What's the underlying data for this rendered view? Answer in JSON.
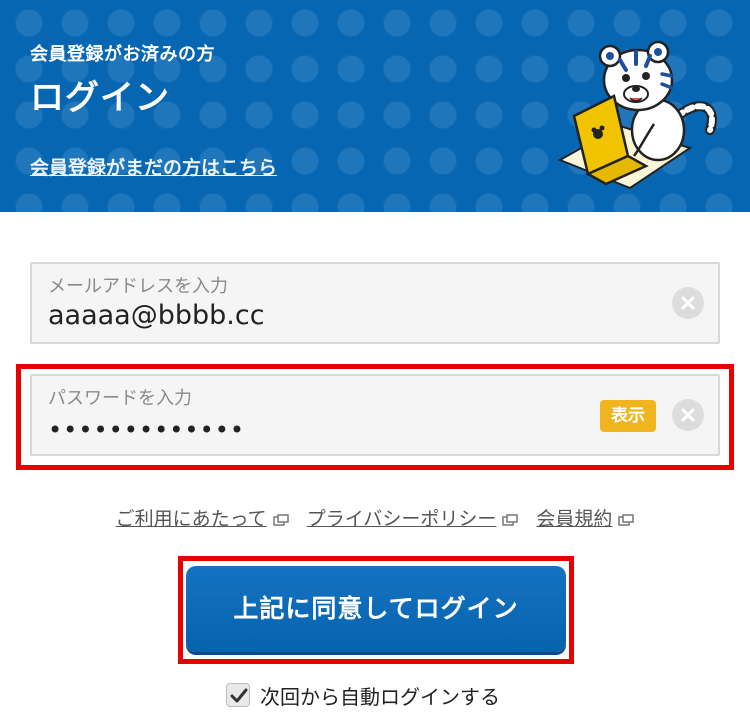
{
  "header": {
    "subtitle": "会員登録がお済みの方",
    "title": "ログイン",
    "register_link": "会員登録がまだの方はこちら"
  },
  "email_field": {
    "label": "メールアドレスを入力",
    "value": "aaaaa@bbbb.cc"
  },
  "password_field": {
    "label": "パスワードを入力",
    "value": "•••••••••••••",
    "show_label": "表示"
  },
  "links": [
    {
      "label": "ご利用にあたって"
    },
    {
      "label": "プライバシーポリシー"
    },
    {
      "label": "会員規約"
    }
  ],
  "login_button": {
    "label": "上記に同意してログイン"
  },
  "auto_login": {
    "label": "次回から自動ログインする",
    "checked": true
  },
  "colors": {
    "header_bg": "#0766b2",
    "button_bg": "#0662ad",
    "show_badge": "#f0b51e",
    "highlight": "#e60000"
  }
}
